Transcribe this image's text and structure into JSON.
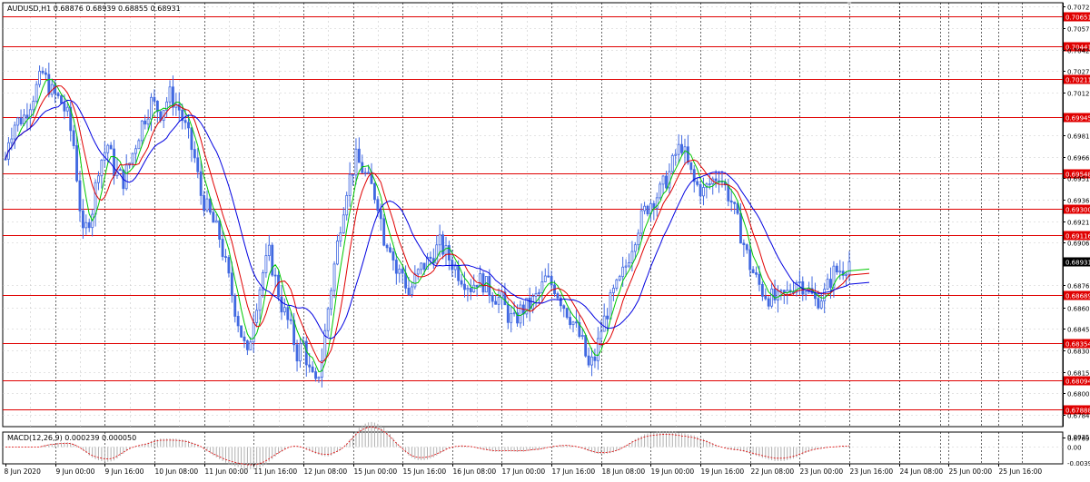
{
  "chart_data": {
    "type": "candlestick",
    "symbol_header": "AUDUSD,H1  0.68876 0.68939 0.68855 0.68931",
    "price_axis": {
      "ylim": [
        0.67765,
        0.7075
      ],
      "tick_labels": [
        "0.70725",
        "0.70570",
        "0.70420",
        "0.70270",
        "0.70120",
        "0.69815",
        "0.69665",
        "0.69515",
        "0.69365",
        "0.69210",
        "0.69060",
        "0.68760",
        "0.68605",
        "0.68455",
        "0.68300",
        "0.68150",
        "0.68000",
        "0.67845",
        "0.67690"
      ]
    },
    "current_price": "0.68931",
    "horizontal_levels": [
      {
        "value": 0.70651,
        "label": "0.70651"
      },
      {
        "value": 0.70441,
        "label": "0.70441"
      },
      {
        "value": 0.70211,
        "label": "0.70211"
      },
      {
        "value": 0.69945,
        "label": "0.69945"
      },
      {
        "value": 0.69548,
        "label": "0.69548"
      },
      {
        "value": 0.693,
        "label": "0.69300"
      },
      {
        "value": 0.69116,
        "label": "0.69116"
      },
      {
        "value": 0.68689,
        "label": "0.68689"
      },
      {
        "value": 0.68354,
        "label": "0.68354"
      },
      {
        "value": 0.68094,
        "label": "0.68094"
      },
      {
        "value": 0.67888,
        "label": "0.67888"
      }
    ],
    "time_labels": [
      "8 Jun 2020",
      "9 Jun 00:00",
      "9 Jun 16:00",
      "10 Jun 08:00",
      "11 Jun 00:00",
      "11 Jun 16:00",
      "12 Jun 08:00",
      "15 Jun 00:00",
      "15 Jun 16:00",
      "16 Jun 08:00",
      "17 Jun 00:00",
      "17 Jun 16:00",
      "18 Jun 08:00",
      "19 Jun 00:00",
      "19 Jun 16:00",
      "22 Jun 08:00",
      "23 Jun 00:00",
      "23 Jun 16:00",
      "24 Jun 08:00",
      "25 Jun 00:00",
      "25 Jun 16:00"
    ],
    "price_path": [
      [
        0,
        0.6965
      ],
      [
        1,
        0.698
      ],
      [
        3,
        0.699
      ],
      [
        6,
        0.6995
      ],
      [
        9,
        0.701
      ],
      [
        12,
        0.7025
      ],
      [
        15,
        0.7012
      ],
      [
        18,
        0.7005
      ],
      [
        20,
        0.6995
      ],
      [
        22,
        0.6975
      ],
      [
        25,
        0.691
      ],
      [
        28,
        0.693
      ],
      [
        30,
        0.696
      ],
      [
        33,
        0.6975
      ],
      [
        35,
        0.6958
      ],
      [
        38,
        0.695
      ],
      [
        40,
        0.6962
      ],
      [
        44,
        0.699
      ],
      [
        47,
        0.7005
      ],
      [
        50,
        0.6998
      ],
      [
        53,
        0.701
      ],
      [
        56,
        0.7
      ],
      [
        59,
        0.698
      ],
      [
        61,
        0.6965
      ],
      [
        63,
        0.694
      ],
      [
        66,
        0.6925
      ],
      [
        69,
        0.691
      ],
      [
        72,
        0.688
      ],
      [
        74,
        0.686
      ],
      [
        76,
        0.6842
      ],
      [
        78,
        0.6825
      ],
      [
        80,
        0.6855
      ],
      [
        83,
        0.6885
      ],
      [
        85,
        0.6898
      ],
      [
        87,
        0.688
      ],
      [
        89,
        0.6862
      ],
      [
        92,
        0.6845
      ],
      [
        94,
        0.6828
      ],
      [
        96,
        0.6835
      ],
      [
        98,
        0.6815
      ],
      [
        100,
        0.6805
      ],
      [
        102,
        0.6825
      ],
      [
        104,
        0.686
      ],
      [
        106,
        0.689
      ],
      [
        108,
        0.692
      ],
      [
        110,
        0.6945
      ],
      [
        113,
        0.6965
      ],
      [
        115,
        0.6958
      ],
      [
        118,
        0.6945
      ],
      [
        120,
        0.6935
      ],
      [
        122,
        0.691
      ],
      [
        124,
        0.6905
      ],
      [
        126,
        0.6885
      ],
      [
        128,
        0.6885
      ],
      [
        130,
        0.687
      ],
      [
        132,
        0.688
      ],
      [
        134,
        0.6888
      ],
      [
        137,
        0.6895
      ],
      [
        140,
        0.6905
      ],
      [
        143,
        0.6895
      ],
      [
        146,
        0.6885
      ],
      [
        148,
        0.688
      ],
      [
        150,
        0.6875
      ],
      [
        152,
        0.688
      ],
      [
        154,
        0.6878
      ],
      [
        157,
        0.687
      ],
      [
        160,
        0.6865
      ],
      [
        162,
        0.6855
      ],
      [
        164,
        0.685
      ],
      [
        166,
        0.6858
      ],
      [
        169,
        0.6862
      ],
      [
        172,
        0.687
      ],
      [
        174,
        0.688
      ],
      [
        177,
        0.6875
      ],
      [
        180,
        0.6862
      ],
      [
        183,
        0.685
      ],
      [
        186,
        0.6835
      ],
      [
        188,
        0.6818
      ],
      [
        190,
        0.6825
      ],
      [
        192,
        0.6845
      ],
      [
        194,
        0.6858
      ],
      [
        196,
        0.687
      ],
      [
        198,
        0.6878
      ],
      [
        200,
        0.689
      ],
      [
        202,
        0.6905
      ],
      [
        204,
        0.6918
      ],
      [
        206,
        0.6928
      ],
      [
        208,
        0.6935
      ],
      [
        211,
        0.6942
      ],
      [
        214,
        0.6955
      ],
      [
        216,
        0.6968
      ],
      [
        218,
        0.6975
      ],
      [
        220,
        0.696
      ],
      [
        222,
        0.6948
      ],
      [
        225,
        0.6942
      ],
      [
        228,
        0.695
      ],
      [
        230,
        0.6955
      ],
      [
        232,
        0.6945
      ],
      [
        234,
        0.6935
      ],
      [
        236,
        0.692
      ],
      [
        238,
        0.6905
      ],
      [
        240,
        0.689
      ],
      [
        242,
        0.688
      ],
      [
        244,
        0.6872
      ],
      [
        246,
        0.6868
      ],
      [
        249,
        0.6865
      ],
      [
        252,
        0.687
      ],
      [
        255,
        0.688
      ],
      [
        258,
        0.6875
      ],
      [
        261,
        0.6865
      ],
      [
        264,
        0.687
      ],
      [
        267,
        0.6885
      ],
      [
        270,
        0.6888
      ],
      [
        272,
        0.6893
      ]
    ],
    "moving_averages": [
      {
        "color": "#00c800",
        "period": 5
      },
      {
        "color": "#e00000",
        "period": 9
      },
      {
        "color": "#0000e0",
        "period": 18
      }
    ],
    "macd": {
      "header": "MACD(12,26,9) 0.000239 0.000050",
      "tick_labels": [
        "0.00353",
        "0.00",
        "-0.00397"
      ],
      "ylim": [
        -0.00397,
        0.00353
      ]
    },
    "colors": {
      "candle": "#4169e1",
      "level": "#e00000",
      "level_label_bg": "#e00000",
      "grid": "#c0c0c0",
      "current_label_bg": "#000000"
    },
    "grid": true
  }
}
